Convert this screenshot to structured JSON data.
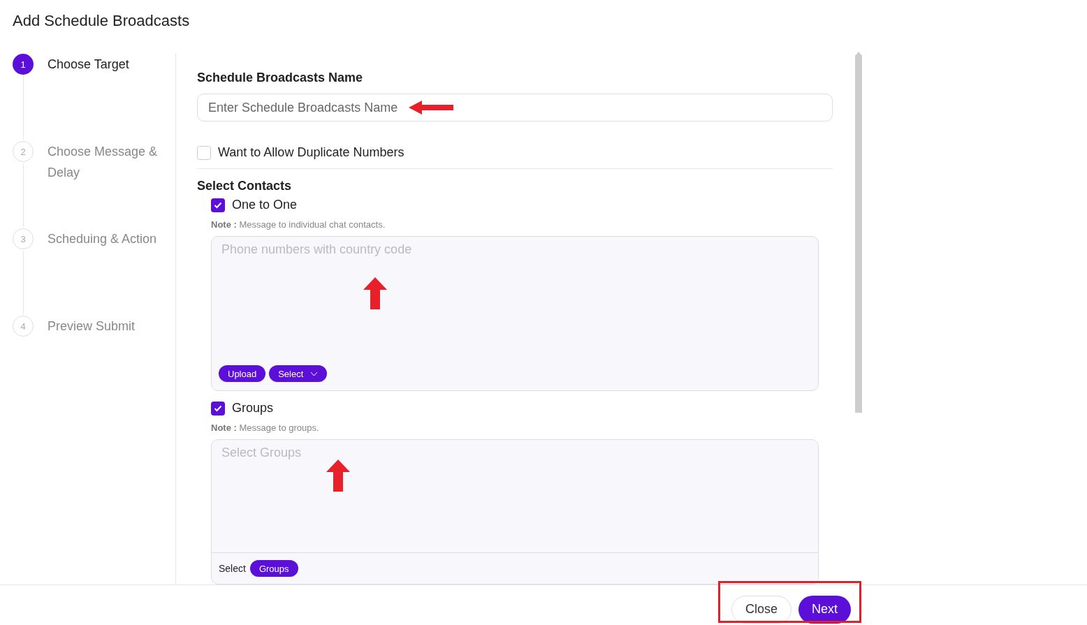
{
  "title": "Add Schedule Broadcasts",
  "steps": [
    {
      "number": "1",
      "label": "Choose Target",
      "selected": true
    },
    {
      "number": "2",
      "label": "Choose Message & Delay",
      "selected": false
    },
    {
      "number": "3",
      "label": "Scheduing & Action",
      "selected": false
    },
    {
      "number": "4",
      "label": "Preview Submit",
      "selected": false
    }
  ],
  "name_field": {
    "label": "Schedule Broadcasts Name",
    "placeholder": "Enter Schedule Broadcasts Name"
  },
  "duplicate_option": {
    "label": "Want to Allow Duplicate Numbers",
    "checked": false
  },
  "contacts": {
    "heading": "Select Contacts",
    "options": [
      {
        "kind": "phone",
        "label": "One to One",
        "checked": true,
        "note": "**Note :** Message to individual chat contacts.",
        "placeholder": "Phone numbers with country code",
        "actions": [
          {
            "label": "Upload",
            "dropdown": false
          },
          {
            "label": "Select",
            "dropdown": true
          }
        ]
      },
      {
        "kind": "groups",
        "label": "Groups",
        "checked": true,
        "note": "**Note :** Message to groups.",
        "placeholder": "Select Groups",
        "footer_label": "Select",
        "actions": [
          {
            "label": "Groups",
            "dropdown": false
          }
        ]
      }
    ]
  },
  "footer_buttons": [
    {
      "label": "Close",
      "kind": "secondary"
    },
    {
      "label": "Next",
      "kind": "primary"
    }
  ]
}
